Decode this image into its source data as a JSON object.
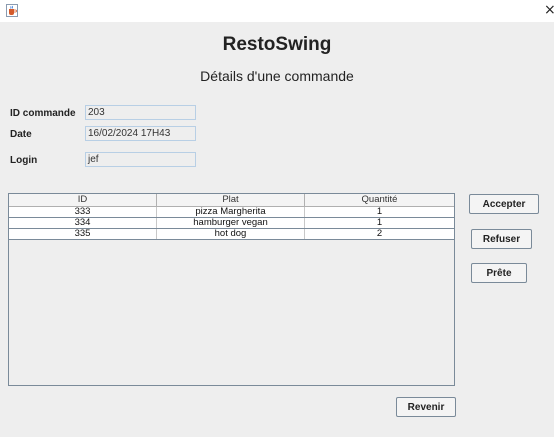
{
  "window": {
    "title_icon": "java-cup-icon",
    "close_glyph": "×"
  },
  "header": {
    "app_title": "RestoSwing",
    "subtitle": "Détails d'une commande"
  },
  "form": {
    "id_label": "ID commande",
    "id_value": "203",
    "date_label": "Date",
    "date_value": "16/02/2024 17H43",
    "login_label": "Login",
    "login_value": "jef"
  },
  "table": {
    "columns": [
      "ID",
      "Plat",
      "Quantité"
    ],
    "rows": [
      [
        "333",
        "pizza Margherita",
        "1"
      ],
      [
        "334",
        "hamburger vegan",
        "1"
      ],
      [
        "335",
        "hot dog",
        "2"
      ]
    ]
  },
  "actions": {
    "accept_label": "Accepter",
    "refuse_label": "Refuser",
    "ready_label": "Prête",
    "back_label": "Revenir"
  }
}
